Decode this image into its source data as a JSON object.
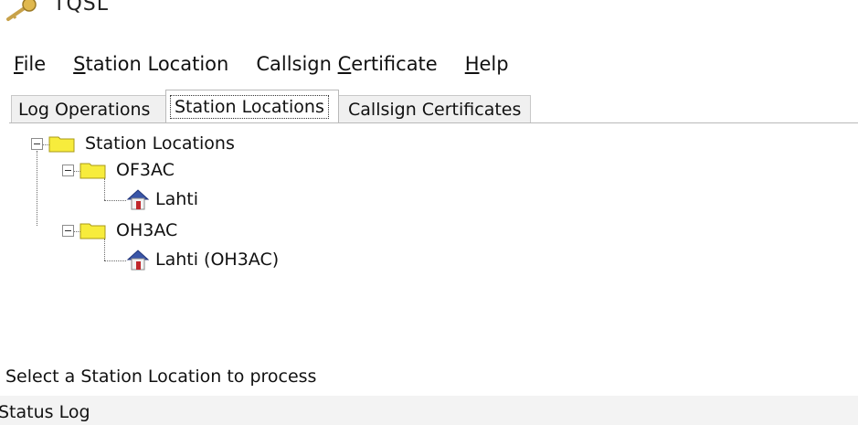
{
  "window": {
    "title": "TQSL",
    "icon": "key-icon"
  },
  "menu": [
    {
      "label_pre": "",
      "underline": "F",
      "label_post": "ile"
    },
    {
      "label_pre": "",
      "underline": "S",
      "label_post": "tation Location"
    },
    {
      "label_pre": "Callsign ",
      "underline": "C",
      "label_post": "ertificate"
    },
    {
      "label_pre": "",
      "underline": "H",
      "label_post": "elp"
    }
  ],
  "tabs": [
    {
      "label": "Log Operations",
      "active": false
    },
    {
      "label": "Station Locations",
      "active": true
    },
    {
      "label": "Callsign Certificates",
      "active": false
    }
  ],
  "tree": {
    "root": {
      "label": "Station Locations",
      "icon": "folder-icon"
    },
    "groups": [
      {
        "label": "OF3AC",
        "icon": "folder-icon",
        "children": [
          {
            "label": "Lahti",
            "icon": "house-icon"
          }
        ]
      },
      {
        "label": "OH3AC",
        "icon": "folder-icon",
        "children": [
          {
            "label": "Lahti (OH3AC)",
            "icon": "house-icon"
          }
        ]
      }
    ]
  },
  "status": {
    "message": "Select a Station Location to process",
    "log_label": "Status Log"
  },
  "colors": {
    "folder": "#f7ec3c",
    "roof": "#3a56a8",
    "door": "#c0282c"
  }
}
